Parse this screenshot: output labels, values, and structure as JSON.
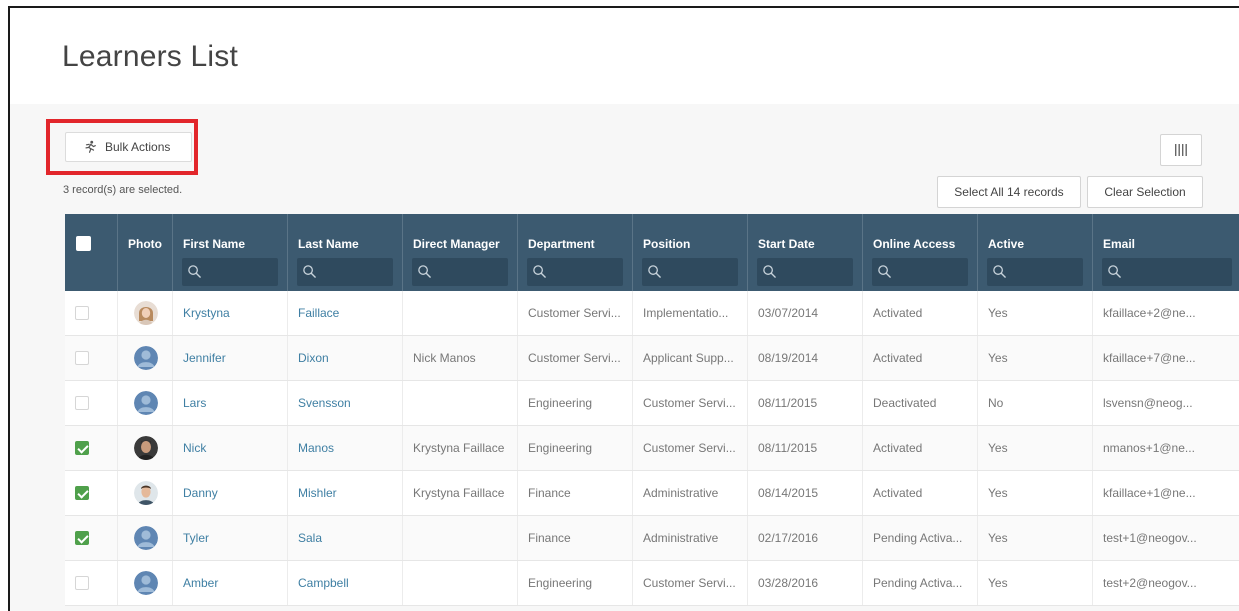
{
  "page": {
    "title": "Learners List"
  },
  "toolbar": {
    "bulk_actions_label": "Bulk Actions",
    "selection_note": "3 record(s) are selected.",
    "select_all_label": "Select All 14 records",
    "clear_selection_label": "Clear Selection",
    "highlight_color": "#e2262b"
  },
  "table": {
    "header_color": "#3c5a70",
    "columns": [
      "Photo",
      "First Name",
      "Last Name",
      "Direct Manager",
      "Department",
      "Position",
      "Start Date",
      "Online Access",
      "Active",
      "Email"
    ],
    "rows": [
      {
        "selected": false,
        "avatar": "photo-female",
        "first": "Krystyna",
        "last": "Faillace",
        "manager": "",
        "department": "Customer Servi...",
        "position": "Implementatio...",
        "start": "03/07/2014",
        "access": "Activated",
        "active": "Yes",
        "email": "kfaillace+2@ne..."
      },
      {
        "selected": false,
        "avatar": "placeholder",
        "first": "Jennifer",
        "last": "Dixon",
        "manager": "Nick Manos",
        "department": "Customer Servi...",
        "position": "Applicant Supp...",
        "start": "08/19/2014",
        "access": "Activated",
        "active": "Yes",
        "email": "kfaillace+7@ne..."
      },
      {
        "selected": false,
        "avatar": "placeholder",
        "first": "Lars",
        "last": "Svensson",
        "manager": "",
        "department": "Engineering",
        "position": "Customer Servi...",
        "start": "08/11/2015",
        "access": "Deactivated",
        "active": "No",
        "email": "lsvensn@neog..."
      },
      {
        "selected": true,
        "avatar": "photo-male-dark",
        "first": "Nick",
        "last": "Manos",
        "manager": "Krystyna Faillace",
        "department": "Engineering",
        "position": "Customer Servi...",
        "start": "08/11/2015",
        "access": "Activated",
        "active": "Yes",
        "email": "nmanos+1@ne..."
      },
      {
        "selected": true,
        "avatar": "photo-male",
        "first": "Danny",
        "last": "Mishler",
        "manager": "Krystyna Faillace",
        "department": "Finance",
        "position": "Administrative",
        "start": "08/14/2015",
        "access": "Activated",
        "active": "Yes",
        "email": "kfaillace+1@ne..."
      },
      {
        "selected": true,
        "avatar": "placeholder",
        "first": "Tyler",
        "last": "Sala",
        "manager": "",
        "department": "Finance",
        "position": "Administrative",
        "start": "02/17/2016",
        "access": "Pending Activa...",
        "active": "Yes",
        "email": "test+1@neogov..."
      },
      {
        "selected": false,
        "avatar": "placeholder",
        "first": "Amber",
        "last": "Campbell",
        "manager": "",
        "department": "Engineering",
        "position": "Customer Servi...",
        "start": "03/28/2016",
        "access": "Pending Activa...",
        "active": "Yes",
        "email": "test+2@neogov..."
      }
    ]
  }
}
